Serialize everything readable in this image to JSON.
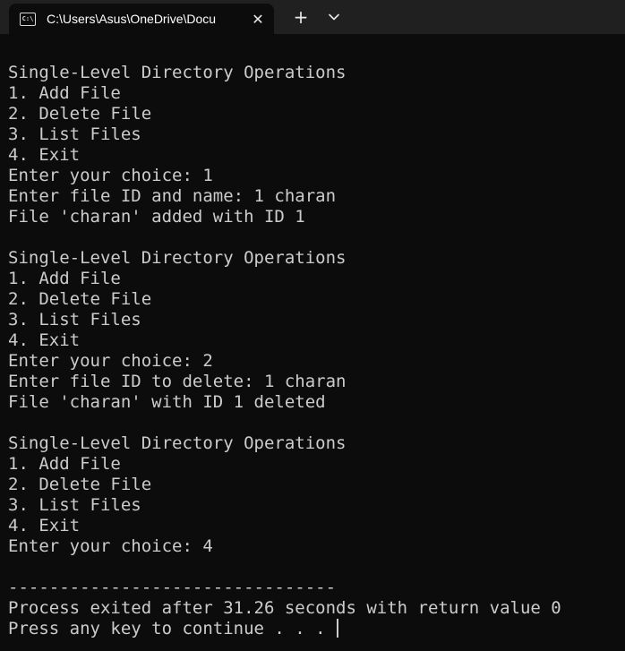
{
  "tab": {
    "icon": "cmd-icon",
    "icon_text": "C:\\",
    "title": "C:\\Users\\Asus\\OneDrive\\Docu"
  },
  "controls": {
    "close_glyph": "✕",
    "new_tab_glyph": "+",
    "dropdown_icon": "chevron-down-icon"
  },
  "console": {
    "lines": [
      "Single-Level Directory Operations",
      "1. Add File",
      "2. Delete File",
      "3. List Files",
      "4. Exit",
      "Enter your choice: 1",
      "Enter file ID and name: 1 charan",
      "File 'charan' added with ID 1",
      "",
      "Single-Level Directory Operations",
      "1. Add File",
      "2. Delete File",
      "3. List Files",
      "4. Exit",
      "Enter your choice: 2",
      "Enter file ID to delete: 1 charan",
      "File 'charan' with ID 1 deleted",
      "",
      "Single-Level Directory Operations",
      "1. Add File",
      "2. Delete File",
      "3. List Files",
      "4. Exit",
      "Enter your choice: 4",
      "",
      "--------------------------------",
      "Process exited after 31.26 seconds with return value 0",
      "Press any key to continue . . . "
    ]
  }
}
